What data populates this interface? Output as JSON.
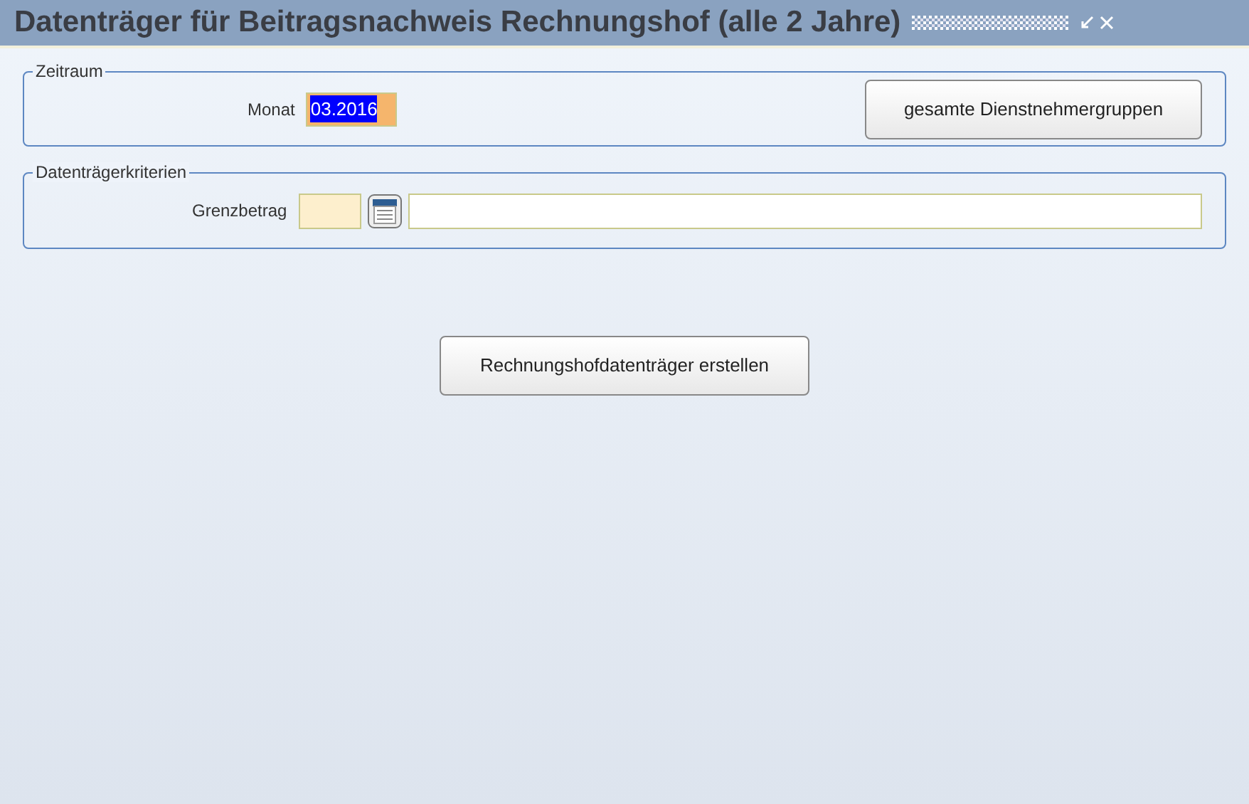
{
  "window": {
    "title": "Datenträger für Beitragsnachweis Rechnungshof (alle 2 Jahre)"
  },
  "zeitraum": {
    "legend": "Zeitraum",
    "month_label": "Monat",
    "month_value": "03.2016",
    "month_text_selected": true,
    "groups_button": "gesamte Dienstnehmergruppen"
  },
  "kriterien": {
    "legend": "Datenträgerkriterien",
    "limit_label": "Grenzbetrag"
  },
  "create_button": "Rechnungshofdatenträger erstellen"
}
